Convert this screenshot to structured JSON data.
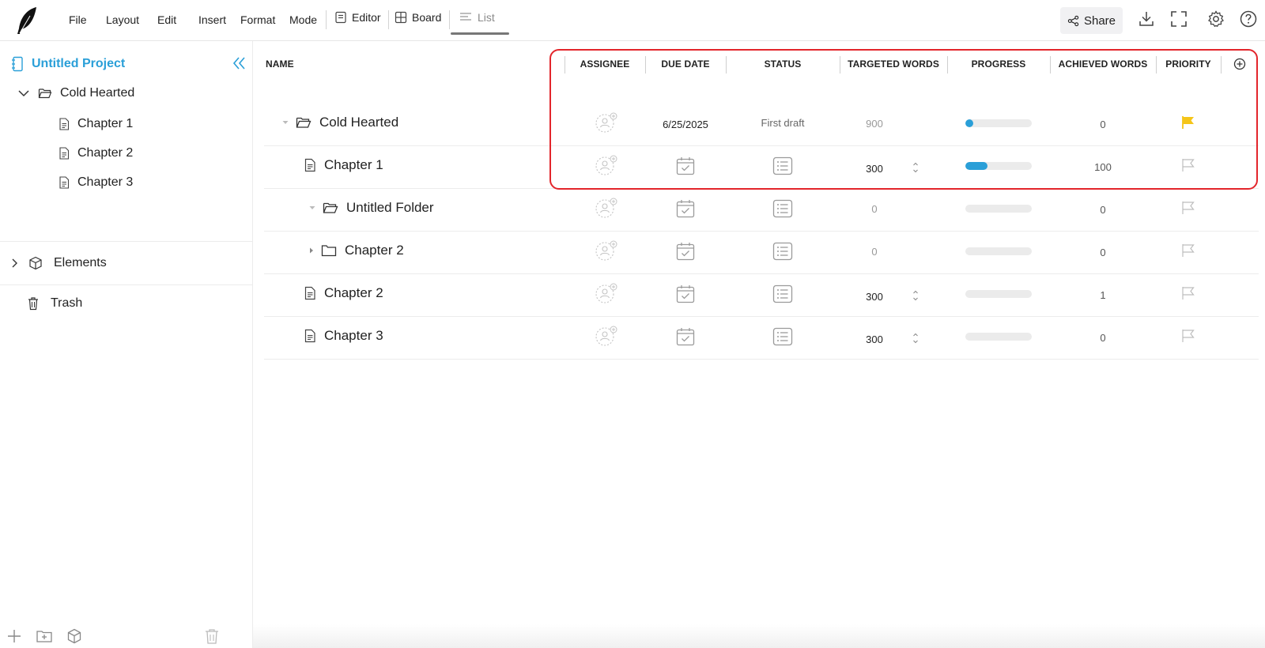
{
  "menu": [
    "File",
    "Layout",
    "Edit",
    "Insert",
    "Format",
    "Mode"
  ],
  "views": {
    "editor": "Editor",
    "board": "Board",
    "list": "List"
  },
  "share_label": "Share",
  "sidebar": {
    "project_title": "Untitled Project",
    "tree": [
      {
        "label": "Cold Hearted",
        "type": "folder",
        "expanded": true
      },
      {
        "label": "Chapter 1",
        "type": "doc"
      },
      {
        "label": "Chapter 2",
        "type": "doc"
      },
      {
        "label": "Chapter 3",
        "type": "doc"
      }
    ],
    "elements_label": "Elements",
    "trash_label": "Trash"
  },
  "table": {
    "headers": {
      "name": "NAME",
      "assignee": "ASSIGNEE",
      "due_date": "DUE DATE",
      "status": "STATUS",
      "targeted_words": "TARGETED WORDS",
      "progress": "PROGRESS",
      "achieved_words": "ACHIEVED WORDS",
      "priority": "PRIORITY"
    },
    "rows": [
      {
        "name": "Cold Hearted",
        "type": "folder-open",
        "due_date": "6/25/2025",
        "status": "First draft",
        "targeted_words": "900",
        "progress": 0.05,
        "achieved_words": "0",
        "priority_flag": "yellow"
      },
      {
        "name": "Chapter 1",
        "type": "doc",
        "due_date": "",
        "status": "",
        "targeted_words": "300",
        "progress": 0.33,
        "achieved_words": "100",
        "priority_flag": "none"
      },
      {
        "name": "Untitled Folder",
        "type": "folder-open",
        "due_date": "",
        "status": "",
        "targeted_words": "0",
        "progress": 0,
        "achieved_words": "0",
        "priority_flag": "none"
      },
      {
        "name": "Chapter 2",
        "type": "folder",
        "due_date": "",
        "status": "",
        "targeted_words": "0",
        "progress": 0,
        "achieved_words": "0",
        "priority_flag": "none"
      },
      {
        "name": "Chapter 2",
        "type": "doc",
        "due_date": "",
        "status": "",
        "targeted_words": "300",
        "progress": 0,
        "achieved_words": "1",
        "priority_flag": "none"
      },
      {
        "name": "Chapter 3",
        "type": "doc",
        "due_date": "",
        "status": "",
        "targeted_words": "300",
        "progress": 0,
        "achieved_words": "0",
        "priority_flag": "none"
      }
    ]
  },
  "colors": {
    "accent": "#2a9fd8",
    "priority_flag": "#f5c518",
    "highlight": "#e3252b"
  }
}
